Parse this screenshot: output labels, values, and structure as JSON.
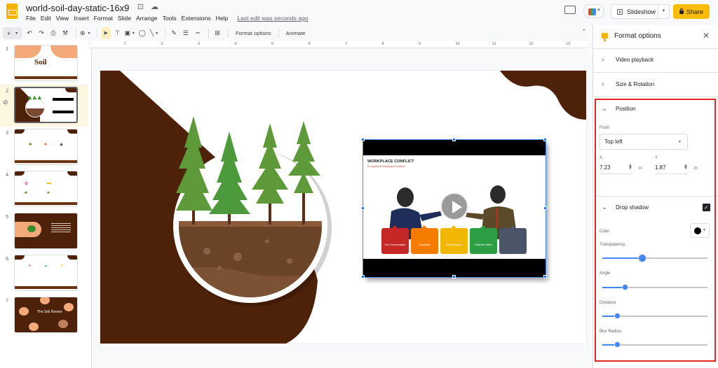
{
  "app": {
    "doc_title": "world-soil-day-static-16x9",
    "title_icons": [
      "star-icon",
      "folder-icon",
      "cloud-icon"
    ],
    "menu": [
      "File",
      "Edit",
      "View",
      "Insert",
      "Format",
      "Slide",
      "Arrange",
      "Tools",
      "Extensions",
      "Help"
    ],
    "last_edit": "Last edit was seconds ago",
    "slideshow_label": "Slideshow",
    "share_label": "Share"
  },
  "toolbar": {
    "format_options_label": "Format options",
    "animate_label": "Animate",
    "icons": [
      "add-icon",
      "undo-icon",
      "redo-icon",
      "print-icon",
      "paint-format-icon",
      "zoom-icon",
      "select-icon",
      "text-box-icon",
      "image-icon",
      "shape-icon",
      "line-icon",
      "border-color-icon",
      "border-weight-icon",
      "border-dash-icon",
      "comment-add-icon"
    ]
  },
  "ruler": {
    "marks": [
      "1",
      "2",
      "3",
      "4",
      "5",
      "6",
      "7",
      "8",
      "9",
      "10",
      "11",
      "12",
      "13"
    ]
  },
  "filmstrip": {
    "active_index": 2,
    "slides": [
      {
        "num": "1",
        "desc": "World Soil Day title"
      },
      {
        "num": "2",
        "desc": "Trees and video"
      },
      {
        "num": "3",
        "desc": "Infographic"
      },
      {
        "num": "4",
        "desc": "Infographic"
      },
      {
        "num": "5",
        "desc": "Quote over soil"
      },
      {
        "num": "6",
        "desc": "Infographic"
      },
      {
        "num": "7",
        "desc": "Hands with plants"
      }
    ]
  },
  "video": {
    "title": "WORKPLACE CONFLICT",
    "subtitle": "5 Culprits of Workplace Conflict",
    "cards": [
      {
        "label": "Poor Communication",
        "color": "#c62828"
      },
      {
        "label": "Competition",
        "color": "#f57c00"
      },
      {
        "label": "Personal issues",
        "color": "#f2b705"
      },
      {
        "label": "Dissimilar Values",
        "color": "#2e9e44"
      },
      {
        "label": "",
        "color": "#4a5568"
      }
    ]
  },
  "panel": {
    "title": "Format options",
    "sections": {
      "video_playback": "Video playback",
      "size_rotation": "Size & Rotation",
      "position": "Position",
      "drop_shadow": "Drop shadow"
    },
    "position": {
      "from_label": "From",
      "from_value": "Top left",
      "x_label": "X",
      "x_value": "7.23",
      "y_label": "Y",
      "y_value": "1.87",
      "unit": "in"
    },
    "drop_shadow": {
      "enabled": true,
      "color_label": "Color",
      "color_value": "#000000",
      "sliders": [
        {
          "label": "Transparency",
          "value": 0.38
        },
        {
          "label": "Angle",
          "value": 0.21
        },
        {
          "label": "Distance",
          "value": 0.14
        },
        {
          "label": "Blur Radius",
          "value": 0.14
        }
      ]
    }
  },
  "colors": {
    "accent": "#fbbc04",
    "soil_brown": "#4e2208",
    "selection_blue": "#1a73e8",
    "highlight_red": "#e52521"
  }
}
